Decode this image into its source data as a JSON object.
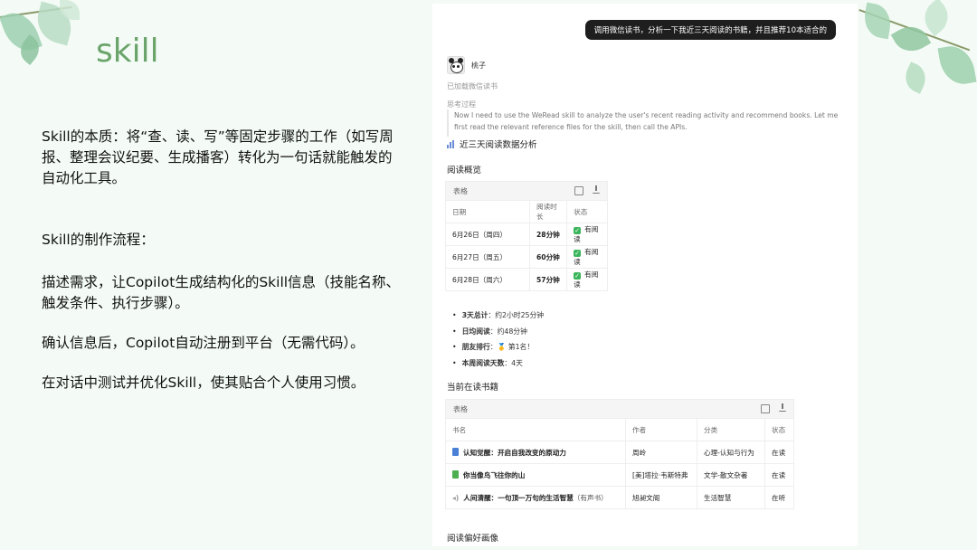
{
  "slide": {
    "title": "skill",
    "para1": "Skill的本质：将“查、读、写”等固定步骤的工作（如写周报、整理会议纪要、生成播客）转化为一句话就能触发的自动化工具。",
    "para2": "Skill的制作流程：",
    "para3": "描述需求，让Copilot生成结构化的Skill信息（技能名称、触发条件、执行步骤）。",
    "para4": "确认信息后，Copilot自动注册到平台（无需代码）。",
    "para5": "在对话中测试并优化Skill，使其贴合个人使用习惯。"
  },
  "chat": {
    "user_message": "调用微信读书，分析一下我近三天阅读的书籍，并且推荐10本适合的",
    "agent_name": "桃子",
    "status": "已加载微信读书",
    "thinking_label": "思考过程",
    "thinking_text": "Now I need to use the WeRead skill to analyze the user's recent reading activity and recommend books. Let me first read the relevant reference files for the skill, then call the APIs.",
    "analysis_title": "近三天阅读数据分析",
    "overview_title": "阅读概览",
    "table_label": "表格",
    "overview_table": {
      "headers": [
        "日期",
        "阅读时长",
        "状态"
      ],
      "rows": [
        [
          "6月26日（周四）",
          "28分钟",
          "有阅读"
        ],
        [
          "6月27日（周五）",
          "60分钟",
          "有阅读"
        ],
        [
          "6月28日（周六）",
          "57分钟",
          "有阅读"
        ]
      ]
    },
    "bullets": [
      {
        "label": "3天总计",
        "value": "：约2小时25分钟"
      },
      {
        "label": "日均阅读",
        "value": "：约48分钟"
      },
      {
        "label": "朋友排行",
        "value": "：🥇 第1名！"
      },
      {
        "label": "本周阅读天数",
        "value": "：4天"
      }
    ],
    "current_title": "当前在读书籍",
    "books_table": {
      "headers": [
        "书名",
        "作者",
        "分类",
        "状态"
      ],
      "rows": [
        {
          "name": "认知觉醒：开启自我改变的原动力",
          "suffix": "",
          "author": "周岭",
          "category": "心理-认知与行为",
          "status": "在读",
          "icon_color": "#4a7fd6"
        },
        {
          "name": "你当像鸟飞往你的山",
          "suffix": "",
          "author": "[美]塔拉·韦斯特弗",
          "category": "文学-散文杂著",
          "status": "在读",
          "icon_color": "#4caf50"
        },
        {
          "name": "人间清醒：一句顶一万句的生活智慧",
          "suffix": "（有声书）",
          "author": "旭昶文阁",
          "category": "生活智慧",
          "status": "在听",
          "icon_color": "#9e9e9e"
        }
      ]
    },
    "profile_title": "阅读偏好画像"
  }
}
